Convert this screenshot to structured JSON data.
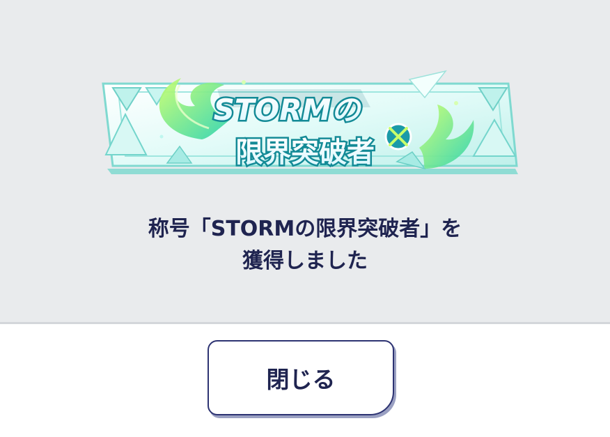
{
  "banner": {
    "line1": "STORMの",
    "line2": "限界突破者"
  },
  "message": {
    "line1": "称号「STORMの限界突破者」を",
    "line2": "獲得しました"
  },
  "close_button": {
    "label": "閉じる"
  },
  "colors": {
    "panel_bg": "#e9ebed",
    "footer_bg": "#ffffff",
    "text": "#1f2450",
    "button_border": "#2d3372",
    "banner_teal": "#3fc9c2",
    "banner_green": "#8ff06a"
  }
}
